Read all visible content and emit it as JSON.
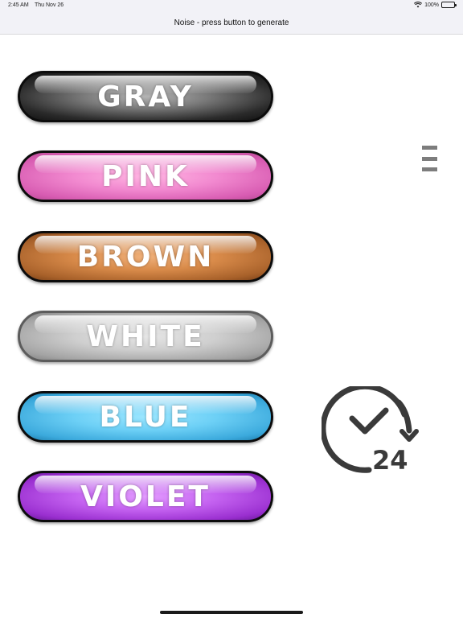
{
  "status_bar": {
    "time": "2:45 AM",
    "date": "Thu Nov 26",
    "battery": "100%"
  },
  "nav": {
    "title": "Noise - press button to generate"
  },
  "buttons": [
    {
      "label": "GRAY",
      "color": "#7a7a7a"
    },
    {
      "label": "PINK",
      "color": "#f28ad0"
    },
    {
      "label": "BROWN",
      "color": "#d98b4a"
    },
    {
      "label": "WHITE",
      "color": "#cfcfcf"
    },
    {
      "label": "BLUE",
      "color": "#6dd0f6"
    },
    {
      "label": "VIOLET",
      "color": "#c462f0"
    }
  ],
  "timer": {
    "hours": "24"
  },
  "icons": {
    "menu": "hamburger-menu-icon",
    "timer": "clock-24-timer-icon"
  }
}
